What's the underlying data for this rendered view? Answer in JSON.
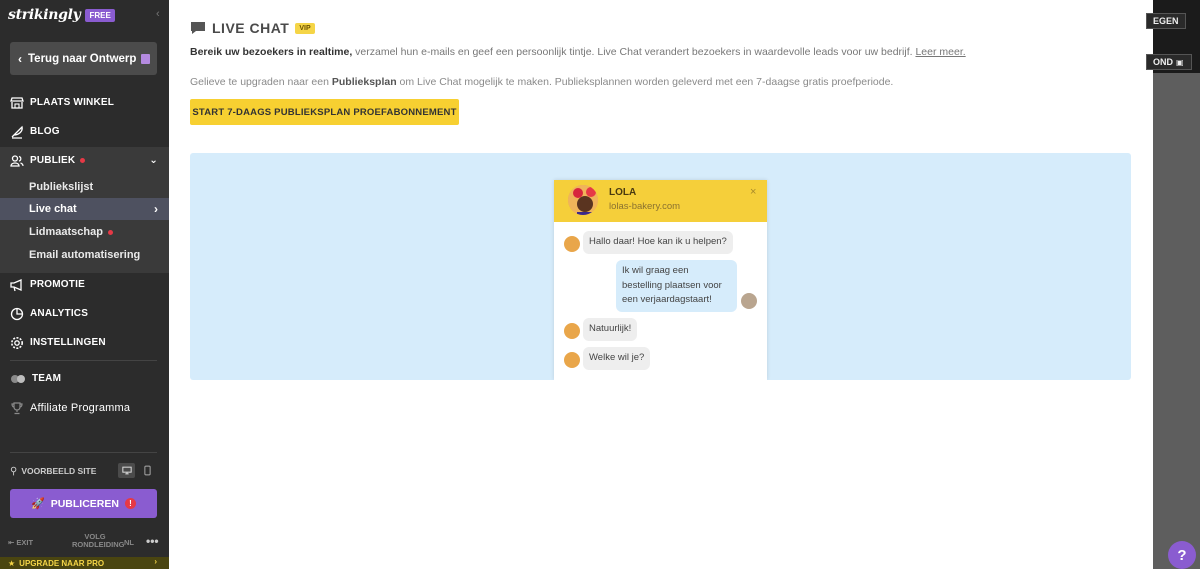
{
  "sidebar": {
    "logo": "strikingly",
    "plan_badge": "FREE",
    "back_label": "Terug naar Ontwerp",
    "nav": {
      "store": "PLAATS WINKEL",
      "blog": "BLOG",
      "audience": "PUBLIEK",
      "promotion": "PROMOTIE",
      "analytics": "ANALYTICS",
      "settings": "INSTELLINGEN",
      "team": "TEAM",
      "affiliate": "Affiliate Programma"
    },
    "sub_items": {
      "audience_list": "Publiekslijst",
      "live_chat": "Live chat",
      "membership": "Lidmaatschap",
      "email_automation": "Email automatisering"
    },
    "preview_label": "VOORBEELD SITE",
    "publish_label": "PUBLICEREN",
    "footer": {
      "exit": "EXIT",
      "tour_line1": "VOLG",
      "tour_line2": "RONDLEIDING",
      "lang": "NL",
      "more": "•••"
    },
    "upgrade_label": "UPGRADE NAAR PRO"
  },
  "main": {
    "title": "LIVE CHAT",
    "vip_badge": "VIP",
    "desc1_bold": "Bereik uw bezoekers in realtime,",
    "desc1_rest": " verzamel hun e-mails en geef een persoonlijk tintje. Live Chat verandert bezoekers in waardevolle leads voor uw bedrijf. ",
    "desc1_link": "Leer meer.",
    "desc2_pre": "Gelieve te upgraden naar een ",
    "desc2_bold": "Publieksplan",
    "desc2_post": " om Live Chat mogelijk te maken. Publieksplannen worden geleverd met een 7-daagse gratis proefperiode.",
    "trial_button": "START 7-DAAGS PUBLIEKSPLAN PROEFABONNEMENT",
    "widget": {
      "name": "LOLA",
      "site": "lolas-bakery.com",
      "close": "×",
      "messages": [
        {
          "from": "bot",
          "text": "Hallo daar! Hoe kan ik u helpen?"
        },
        {
          "from": "user",
          "text": "Ik wil graag een bestelling plaatsen voor een verjaardagstaart!"
        },
        {
          "from": "bot",
          "text": "Natuurlijk!"
        },
        {
          "from": "bot",
          "text": "Welke wil je?"
        }
      ]
    }
  },
  "right_strip": {
    "btn_a": "EGEN",
    "btn_b": "OND"
  },
  "help_label": "?",
  "colors": {
    "sidebar_bg": "#2c2c2c",
    "accent_purple": "#8a5cd0",
    "cta_yellow": "#f7d031",
    "preview_blue": "#d6ecfb",
    "badge_red": "#e63946"
  }
}
